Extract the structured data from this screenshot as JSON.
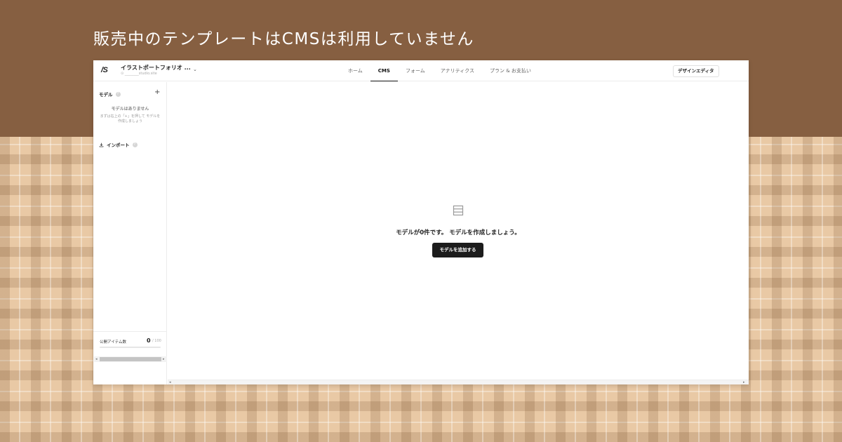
{
  "banner": {
    "title": "販売中のテンプレートはCMSは利用していません"
  },
  "header": {
    "logo": "/S",
    "project_name": "イラストポートフォリオ ...",
    "project_url": "⊙ ________studio.site",
    "chevron": "⌄",
    "tabs": [
      {
        "label": "ホーム",
        "active": false
      },
      {
        "label": "CMS",
        "active": true
      },
      {
        "label": "フォーム",
        "active": false
      },
      {
        "label": "アナリティクス",
        "active": false
      },
      {
        "label": "プラン & お支払い",
        "active": false
      }
    ],
    "design_editor_label": "デザインエディタ"
  },
  "sidebar": {
    "models_label": "モデル",
    "help_glyph": "?",
    "add_glyph": "+",
    "empty_title": "モデルはありません",
    "empty_hint": "まずは右上の「+」を押して モデルを作成しましょう",
    "import_label": "インポート",
    "footer": {
      "label": "公開アイテム数",
      "count": "0",
      "limit": "/ 100",
      "progress": 0
    },
    "scroll_left": "◂",
    "scroll_right": "▸"
  },
  "main": {
    "empty_text": "モデルが0件です。 モデルを作成しましょう。",
    "add_button_label": "モデルを追加する",
    "scroll_left": "◂",
    "scroll_right": "▸"
  },
  "colors": {
    "top_band": "#865f41",
    "primary_button": "#1c1c1c"
  }
}
